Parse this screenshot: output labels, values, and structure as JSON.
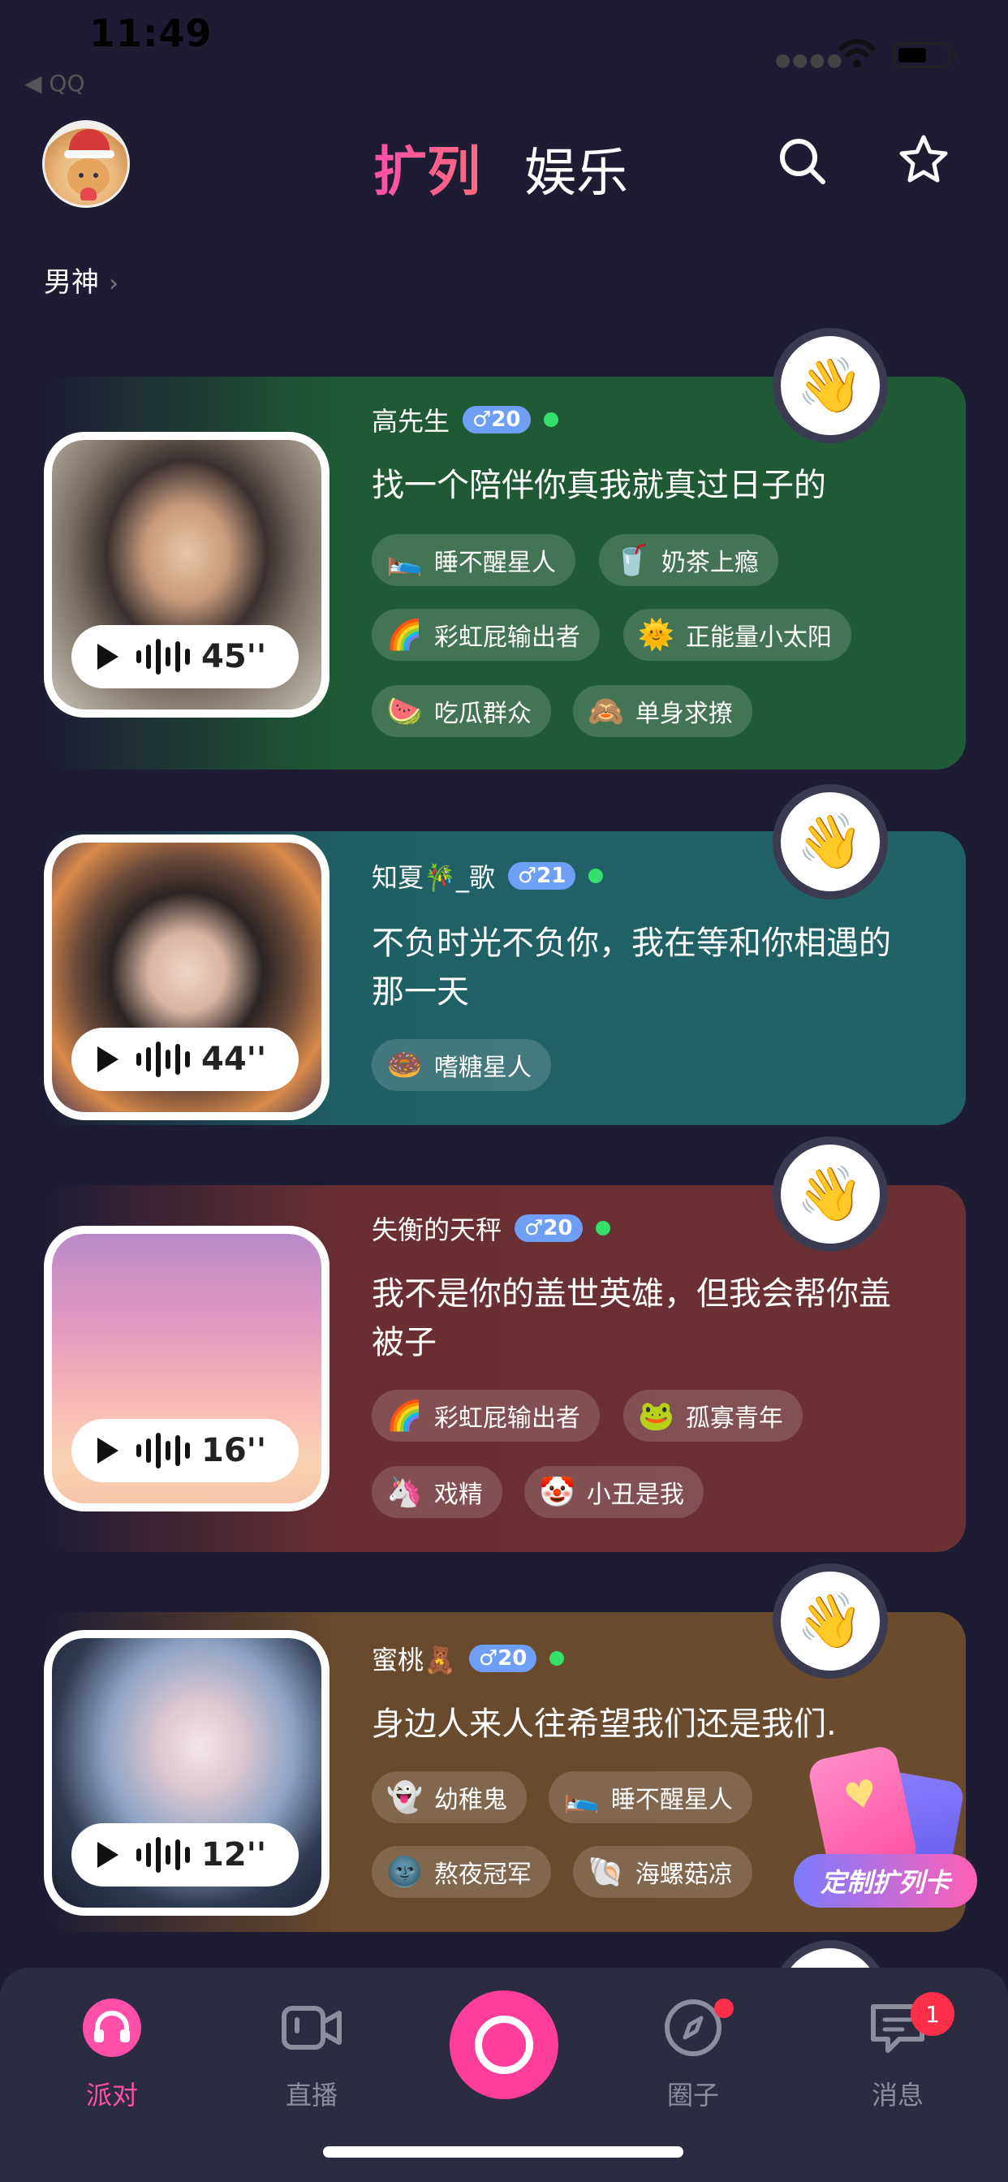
{
  "status_bar": {
    "time": "11:49",
    "back_app": "◀ QQ"
  },
  "header": {
    "tab_active": "扩列",
    "tab_inactive": "娱乐"
  },
  "filter": {
    "label": "男神"
  },
  "cards": [
    {
      "name": "高先生",
      "age_badge": "♂20",
      "duration": "45''",
      "bio": "找一个陪伴你真我就真过日子的",
      "tags": [
        {
          "emoji": "🛌",
          "label": "睡不醒星人"
        },
        {
          "emoji": "🥤",
          "label": "奶茶上瘾"
        },
        {
          "emoji": "🌈",
          "label": "彩虹屁输出者"
        },
        {
          "emoji": "🌞",
          "label": "正能量小太阳"
        },
        {
          "emoji": "🍉",
          "label": "吃瓜群众"
        },
        {
          "emoji": "🙈",
          "label": "单身求撩"
        }
      ]
    },
    {
      "name": "知夏🎋_歌",
      "age_badge": "♂21",
      "duration": "44''",
      "bio": "不负时光不负你，我在等和你相遇的那一天",
      "tags": [
        {
          "emoji": "🍩",
          "label": "嗜糖星人"
        }
      ]
    },
    {
      "name": "失衡的天秤",
      "age_badge": "♂20",
      "duration": "16''",
      "bio": "我不是你的盖世英雄，但我会帮你盖被子",
      "tags": [
        {
          "emoji": "🌈",
          "label": "彩虹屁输出者"
        },
        {
          "emoji": "🐸",
          "label": "孤寡青年"
        },
        {
          "emoji": "🦄",
          "label": "戏精"
        },
        {
          "emoji": "🤡",
          "label": "小丑是我"
        }
      ]
    },
    {
      "name": "蜜桃🧸",
      "age_badge": "♂20",
      "duration": "12''",
      "bio": "身边人来人往希望我们还是我们.",
      "tags": [
        {
          "emoji": "👻",
          "label": "幼稚鬼"
        },
        {
          "emoji": "🛌",
          "label": "睡不醒星人"
        },
        {
          "emoji": "🌚",
          "label": "熬夜冠军"
        },
        {
          "emoji": "🐚",
          "label": "海螺菇凉"
        }
      ]
    }
  ],
  "custom_card": {
    "label": "定制扩列卡"
  },
  "bottom_nav": {
    "items": [
      "派对",
      "直播",
      "圈子",
      "消息"
    ],
    "message_badge": "1"
  },
  "colors": {
    "background": "#1d1c33",
    "accent_pink": "#ff4fa8",
    "card1": "#1f5a34",
    "card2": "#1f5f66",
    "card3": "#6a2f33",
    "card4": "#6a4a2c"
  }
}
